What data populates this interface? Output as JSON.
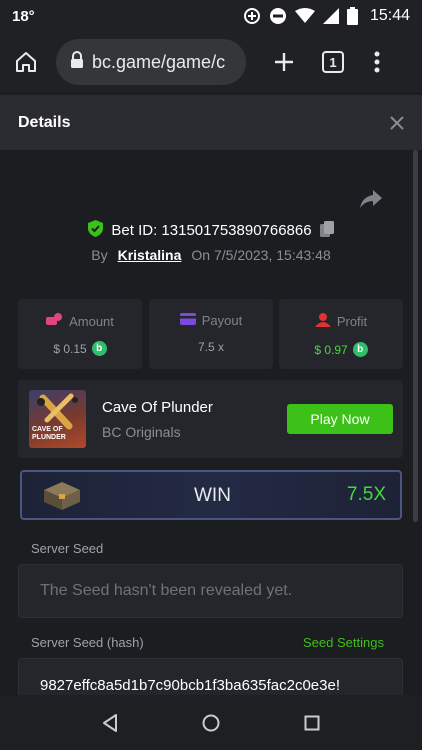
{
  "status_bar": {
    "temperature": "18°",
    "time": "15:44"
  },
  "browser": {
    "url": "bc.game/game/c",
    "tab_count": "1"
  },
  "details": {
    "title": "Details"
  },
  "bet": {
    "id_label": "Bet ID: 131501753890766866",
    "by_label": "By",
    "user": "Kristalina",
    "date": "On 7/5/2023, 15:43:48"
  },
  "stats": [
    {
      "label": "Amount",
      "value": "$ 0.15",
      "icon": "amount-icon",
      "color": "#e0457b"
    },
    {
      "label": "Payout",
      "value": "7.5 x",
      "icon": "payout-icon",
      "color": "#7b4be0"
    },
    {
      "label": "Profit",
      "value": "$ 0.97",
      "icon": "profit-icon",
      "color": "#e0322e"
    }
  ],
  "coin_symbol": "b",
  "game": {
    "name": "Cave Of Plunder",
    "provider": "BC Originals",
    "play_label": "Play Now",
    "thumb_text": "CAVE OF\nPLUNDER"
  },
  "result": {
    "label": "WIN",
    "multiplier": "7.5X"
  },
  "server_seed": {
    "label": "Server Seed",
    "placeholder": "The Seed hasn't been revealed yet."
  },
  "server_seed_hash": {
    "label": "Server Seed (hash)",
    "settings_link": "Seed Settings",
    "value": "9827effc8a5d1b7c90bcb1f3ba635fac2c0e3e!"
  },
  "colors": {
    "accent_green": "#3bc117",
    "profit_green": "#44d93a",
    "background": "#1b1d21"
  }
}
